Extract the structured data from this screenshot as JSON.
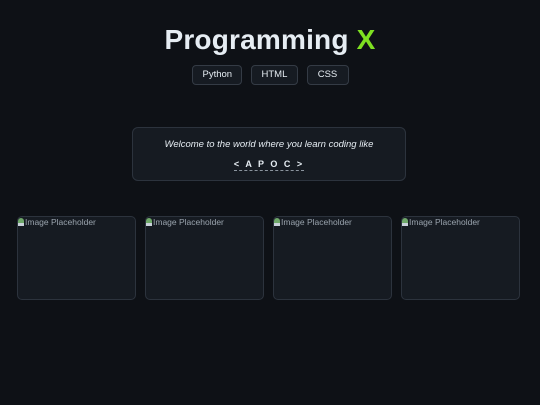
{
  "header": {
    "title_main": "Programming",
    "title_accent": "X"
  },
  "tags": [
    {
      "label": "Python"
    },
    {
      "label": "HTML"
    },
    {
      "label": "CSS"
    }
  ],
  "welcome": {
    "message": "Welcome to the world where you learn coding like",
    "highlight": "< A P O C >"
  },
  "cards": [
    {
      "placeholder": "Image Placeholder"
    },
    {
      "placeholder": "Image Placeholder"
    },
    {
      "placeholder": "Image Placeholder"
    },
    {
      "placeholder": "Image Placeholder"
    }
  ],
  "colors": {
    "background": "#0e1116",
    "accent": "#7ee021",
    "card": "#161b22",
    "border": "#2c333d"
  }
}
